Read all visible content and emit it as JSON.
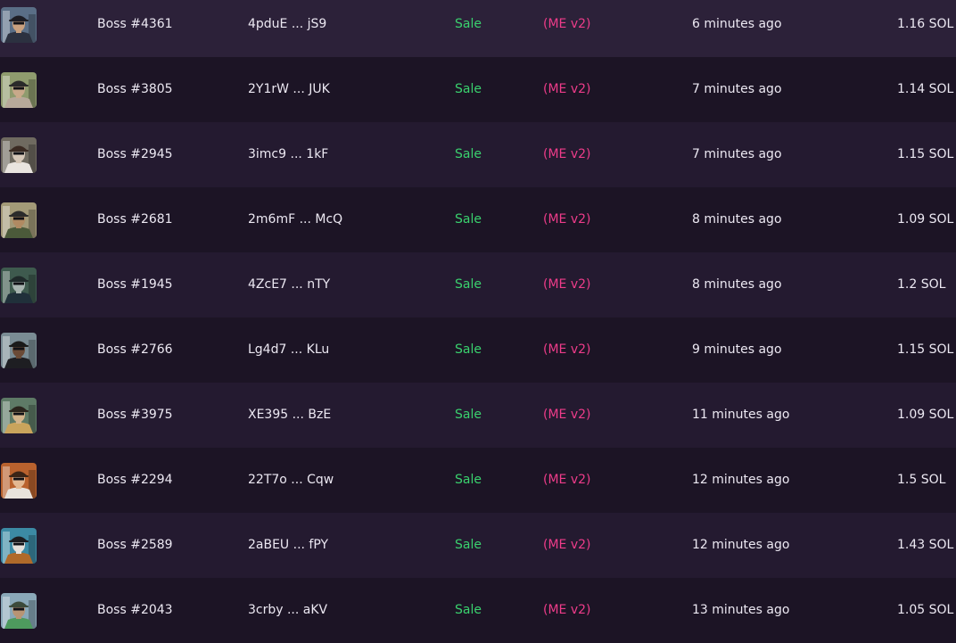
{
  "colors": {
    "row_odd": "#241a30",
    "row_even": "#1c1425",
    "sale": "#3ad16e",
    "marketplace": "#ee3c8a",
    "text": "#ece8f2"
  },
  "rows": [
    {
      "name": "Boss #4361",
      "address": "4pduE ... jS9",
      "type": "Sale",
      "marketplace": "(ME v2)",
      "time": "6 minutes ago",
      "price": "1.16 SOL",
      "bg": "#5a6e86",
      "skin": "#c9a07e",
      "hat": "#1d1d24",
      "shirt": "#2c3140",
      "icon": "nft-thumbnail-icon"
    },
    {
      "name": "Boss #3805",
      "address": "2Y1rW ... JUK",
      "type": "Sale",
      "marketplace": "(ME v2)",
      "time": "7 minutes ago",
      "price": "1.14 SOL",
      "bg": "#8f9b6e",
      "skin": "#c8a98a",
      "hat": "#2a2a2a",
      "shirt": "#b7a99a",
      "icon": "nft-thumbnail-icon"
    },
    {
      "name": "Boss #2945",
      "address": "3imc9 ... 1kF",
      "type": "Sale",
      "marketplace": "(ME v2)",
      "time": "7 minutes ago",
      "price": "1.15 SOL",
      "bg": "#6f6a60",
      "skin": "#d6c7b8",
      "hat": "#3a2a22",
      "shirt": "#e9e4df",
      "icon": "nft-thumbnail-icon"
    },
    {
      "name": "Boss #2681",
      "address": "2m6mF ... McQ",
      "type": "Sale",
      "marketplace": "(ME v2)",
      "time": "8 minutes ago",
      "price": "1.09 SOL",
      "bg": "#a39a78",
      "skin": "#b08a62",
      "hat": "#2b2b2b",
      "shirt": "#4b5a3a",
      "icon": "nft-thumbnail-icon"
    },
    {
      "name": "Boss #1945",
      "address": "4ZcE7 ... nTY",
      "type": "Sale",
      "marketplace": "(ME v2)",
      "time": "8 minutes ago",
      "price": "1.2 SOL",
      "bg": "#3e5a4e",
      "skin": "#a8b4b0",
      "hat": "#1f2a2a",
      "shirt": "#20303a",
      "icon": "nft-thumbnail-icon"
    },
    {
      "name": "Boss #2766",
      "address": "Lg4d7 ... KLu",
      "type": "Sale",
      "marketplace": "(ME v2)",
      "time": "9 minutes ago",
      "price": "1.15 SOL",
      "bg": "#7a8c94",
      "skin": "#6a4a36",
      "hat": "#1a1a1a",
      "shirt": "#1e1e22",
      "icon": "nft-thumbnail-icon"
    },
    {
      "name": "Boss #3975",
      "address": "XE395 ... BzE",
      "type": "Sale",
      "marketplace": "(ME v2)",
      "time": "11 minutes ago",
      "price": "1.09 SOL",
      "bg": "#5e7a66",
      "skin": "#d2b38a",
      "hat": "#2a241c",
      "shirt": "#c9a45c",
      "icon": "nft-thumbnail-icon"
    },
    {
      "name": "Boss #2294",
      "address": "22T7o ... Cqw",
      "type": "Sale",
      "marketplace": "(ME v2)",
      "time": "12 minutes ago",
      "price": "1.5 SOL",
      "bg": "#b9622e",
      "skin": "#e3b892",
      "hat": "#3a2416",
      "shirt": "#e8e2dc",
      "icon": "nft-thumbnail-icon"
    },
    {
      "name": "Boss #2589",
      "address": "2aBEU ... fPY",
      "type": "Sale",
      "marketplace": "(ME v2)",
      "time": "12 minutes ago",
      "price": "1.43 SOL",
      "bg": "#3c8aa4",
      "skin": "#e6e0da",
      "hat": "#1c1c20",
      "shirt": "#b06a2a",
      "icon": "nft-thumbnail-icon"
    },
    {
      "name": "Boss #2043",
      "address": "3crby ... aKV",
      "type": "Sale",
      "marketplace": "(ME v2)",
      "time": "13 minutes ago",
      "price": "1.05 SOL",
      "bg": "#8aa8b8",
      "skin": "#b89474",
      "hat": "#3c4a3a",
      "shirt": "#4e9a5e",
      "icon": "nft-thumbnail-icon"
    }
  ]
}
